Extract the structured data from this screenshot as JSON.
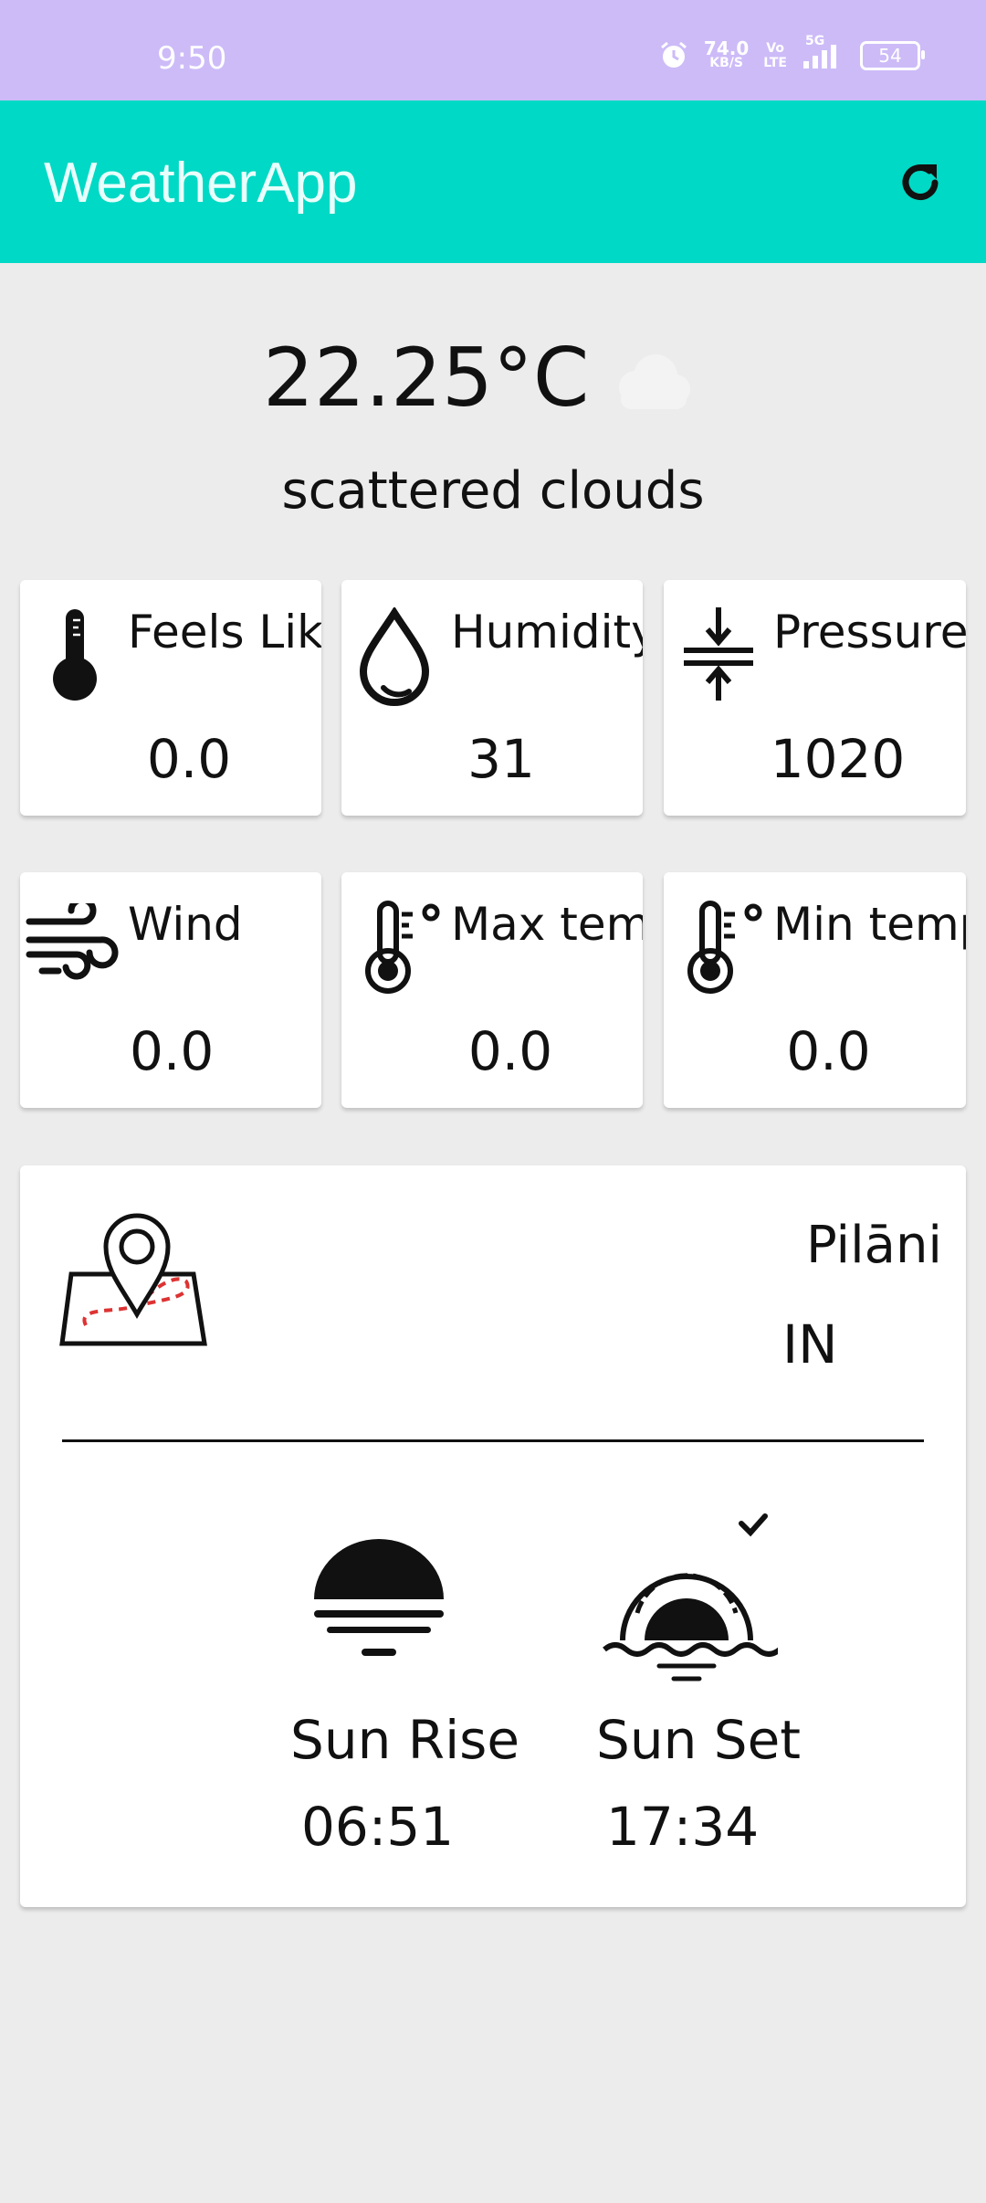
{
  "status_bar": {
    "time": "9:50",
    "net_speed": "74.0",
    "net_unit": "KB/S",
    "volte_top": "Vo",
    "volte_bottom": "LTE",
    "signal_label": "5G",
    "battery": "54"
  },
  "toolbar": {
    "title": "WeatherApp",
    "refresh_icon": "refresh-icon"
  },
  "current": {
    "temperature": "22.25°C",
    "description": "scattered clouds",
    "icon": "cloud-icon"
  },
  "cards": [
    {
      "label": "Feels Like",
      "value": "0.0",
      "icon": "thermometer-icon"
    },
    {
      "label": "Humidity",
      "value": "31",
      "icon": "droplet-icon"
    },
    {
      "label": "Pressure",
      "value": "1020",
      "icon": "pressure-icon"
    },
    {
      "label": "Wind",
      "value": "0.0",
      "icon": "wind-icon"
    },
    {
      "label": "Max temp",
      "value": "0.0",
      "icon": "thermometer-high-icon"
    },
    {
      "label": "Min temp",
      "value": "0.0",
      "icon": "thermometer-low-icon"
    }
  ],
  "location": {
    "city": "Pilāni",
    "country": "IN",
    "icon": "map-pin-icon"
  },
  "sun": {
    "rise_label": "Sun Rise",
    "rise_time": "06:51",
    "set_label": "Sun Set",
    "set_time": "17:34"
  }
}
